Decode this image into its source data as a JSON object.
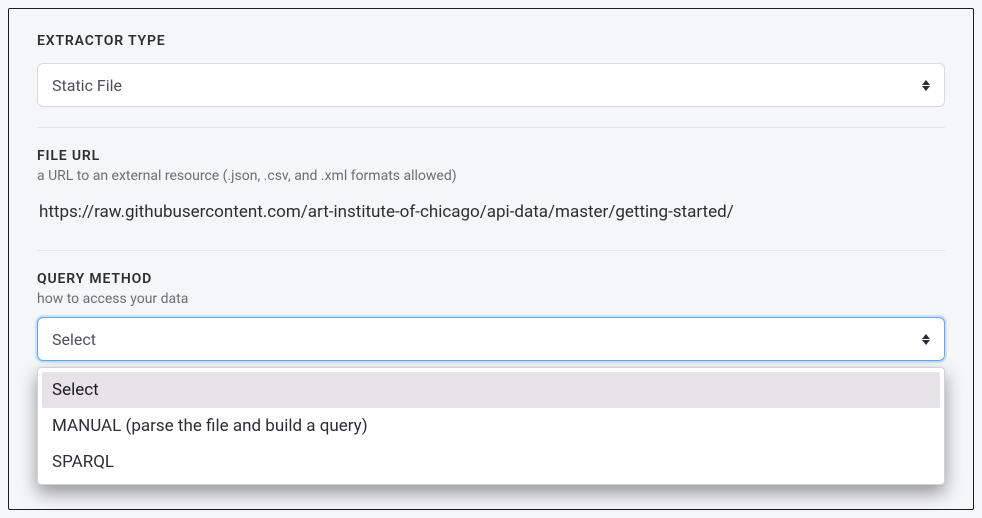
{
  "extractor": {
    "label": "EXTRACTOR TYPE",
    "value": "Static File"
  },
  "fileUrl": {
    "label": "FILE URL",
    "help": "a URL to an external resource (.json, .csv, and .xml formats allowed)",
    "value": "https://raw.githubusercontent.com/art-institute-of-chicago/api-data/master/getting-started/"
  },
  "queryMethod": {
    "label": "QUERY METHOD",
    "help": "how to access your data",
    "value": "Select",
    "options": {
      "0": "Select",
      "1": "MANUAL (parse the file and build a query)",
      "2": "SPARQL"
    }
  }
}
